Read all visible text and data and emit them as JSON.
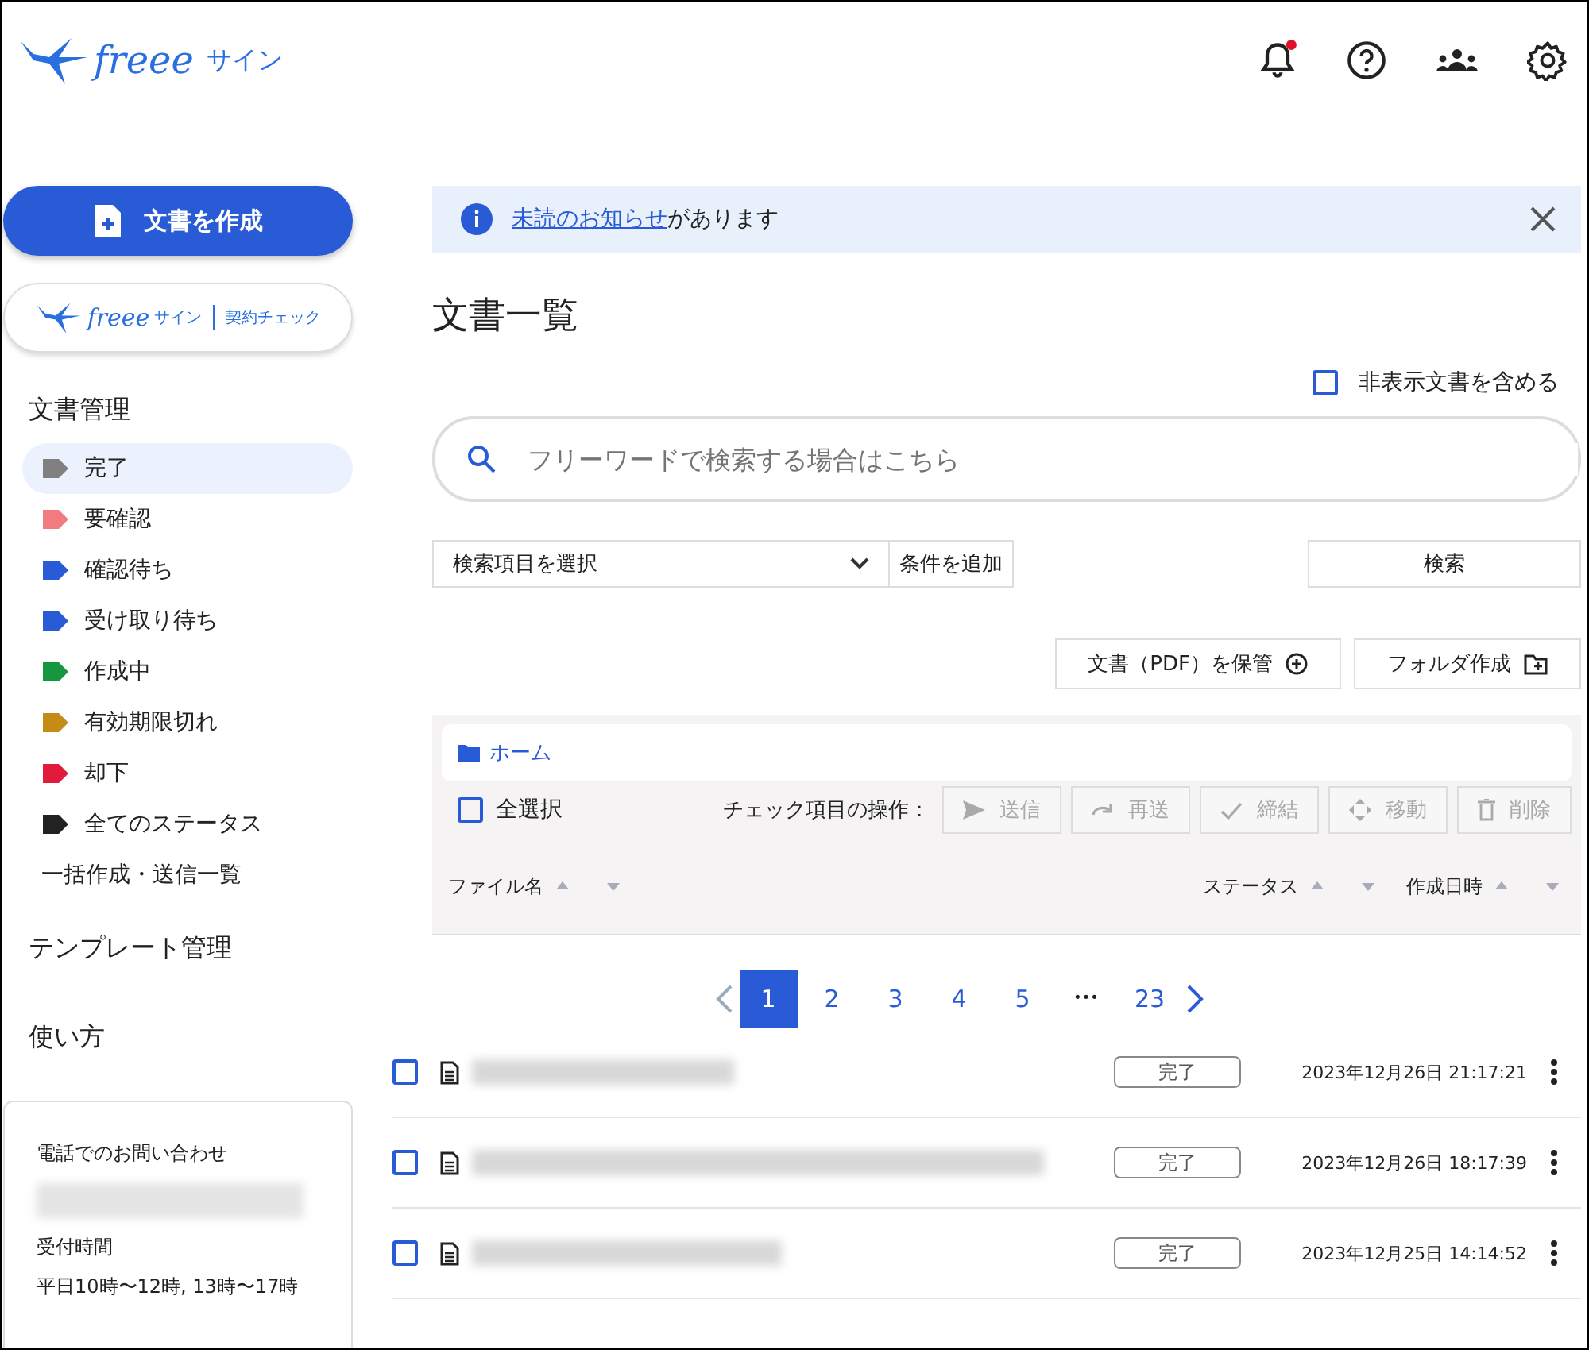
{
  "header": {
    "logo": {
      "brand": "freee",
      "product": "サイン"
    },
    "notification_unread": true
  },
  "sidebar": {
    "create_button": "文書を作成",
    "check_button": {
      "brand": "freee",
      "product": "サイン",
      "service": "契約チェック"
    },
    "section_title": "文書管理",
    "status_items": [
      {
        "label": "完了",
        "color": "#808080",
        "selected": true
      },
      {
        "label": "要確認",
        "color": "#f07c80",
        "selected": false
      },
      {
        "label": "確認待ち",
        "color": "#2a5bd7",
        "selected": false
      },
      {
        "label": "受け取り待ち",
        "color": "#2a5bd7",
        "selected": false
      },
      {
        "label": "作成中",
        "color": "#15963f",
        "selected": false
      },
      {
        "label": "有効期限切れ",
        "color": "#c48b16",
        "selected": false
      },
      {
        "label": "却下",
        "color": "#e21b3c",
        "selected": false
      },
      {
        "label": "全てのステータス",
        "color": "#222222",
        "selected": false
      }
    ],
    "bulk_link": "一括作成・送信一覧",
    "menu": [
      "テンプレート管理",
      "使い方"
    ],
    "contact": {
      "title": "電話でのお問い合わせ",
      "hours_label": "受付時間",
      "hours": "平日10時〜12時, 13時〜17時"
    }
  },
  "notice": {
    "link": "未読のお知らせ",
    "text": "があります"
  },
  "page_title": "文書一覧",
  "hidden_docs": {
    "label": "非表示文書を含める",
    "checked": false
  },
  "search": {
    "placeholder": "フリーワードで検索する場合はこちら",
    "field_select": "検索項目を選択",
    "add_condition": "条件を追加",
    "button": "検索"
  },
  "actions": {
    "store_pdf": "文書（PDF）を保管",
    "new_folder": "フォルダ作成"
  },
  "breadcrumb": "ホーム",
  "select_all": {
    "label": "全選択",
    "checked": false
  },
  "bulk_label": "チェック項目の操作：",
  "bulk_buttons": [
    {
      "kind": "send",
      "label": "送信",
      "disabled": true
    },
    {
      "kind": "resend",
      "label": "再送",
      "disabled": true
    },
    {
      "kind": "sign",
      "label": "締結",
      "disabled": true
    },
    {
      "kind": "move",
      "label": "移動",
      "disabled": true
    },
    {
      "kind": "delete",
      "label": "削除",
      "disabled": true
    }
  ],
  "columns": [
    "ファイル名",
    "ステータス",
    "作成日時"
  ],
  "pagination": {
    "pages": [
      {
        "label": "1",
        "selected": true
      },
      {
        "label": "2",
        "selected": false
      },
      {
        "label": "3",
        "selected": false
      },
      {
        "label": "4",
        "selected": false
      },
      {
        "label": "5",
        "selected": false
      }
    ],
    "ellipsis": "•••",
    "last": {
      "label": "23",
      "selected": false
    }
  },
  "rows": [
    {
      "checked": false,
      "status": "完了",
      "created": "2023年12月26日 21:17:21"
    },
    {
      "checked": false,
      "status": "完了",
      "created": "2023年12月26日 18:17:39"
    },
    {
      "checked": false,
      "status": "完了",
      "created": "2023年12月25日 14:14:52"
    }
  ]
}
